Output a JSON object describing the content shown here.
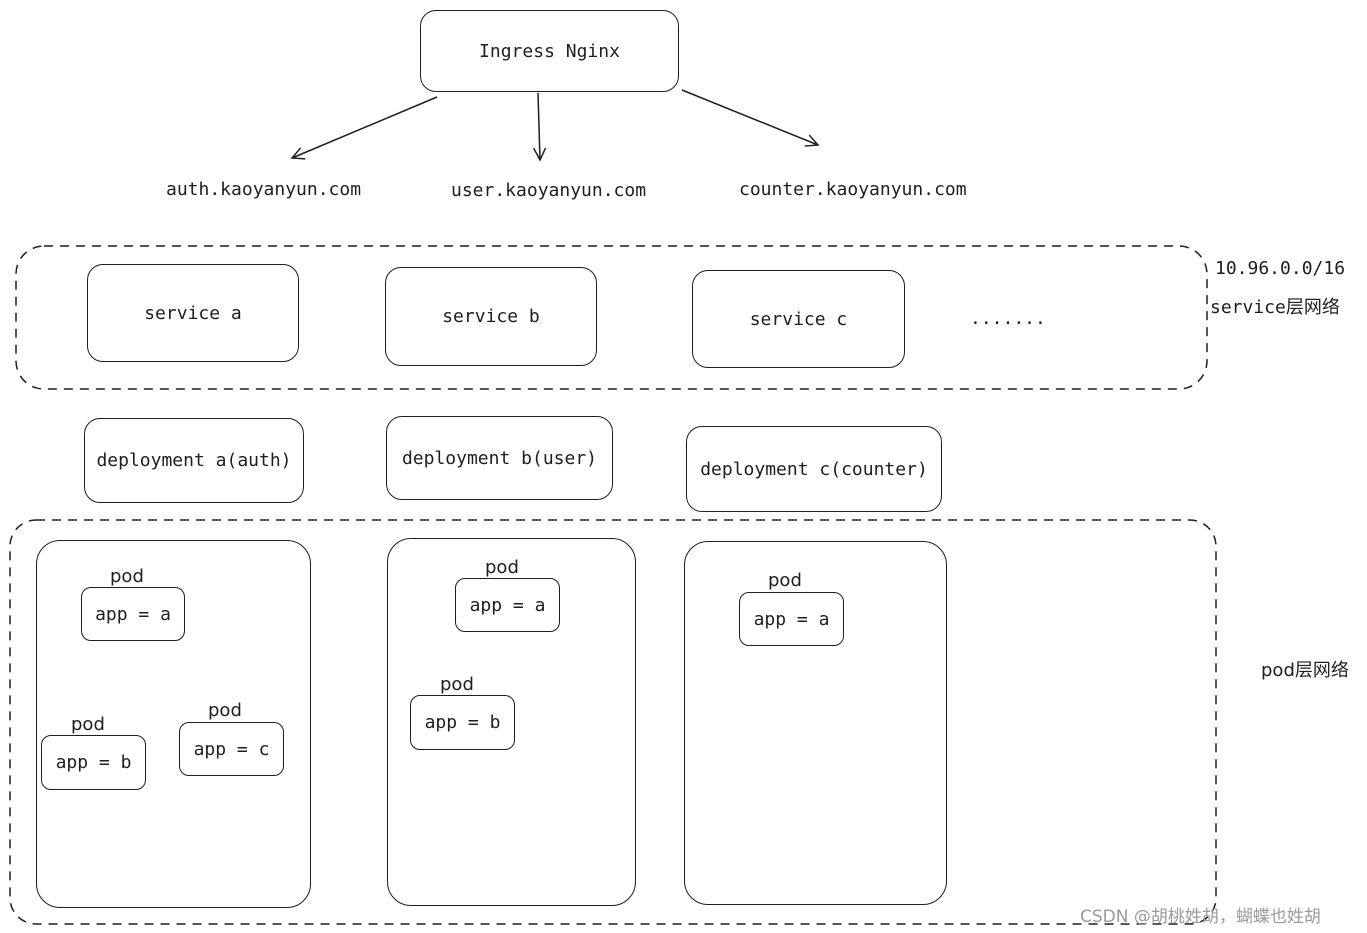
{
  "ingress": {
    "label": "Ingress Nginx"
  },
  "domains": [
    "auth.kaoyanyun.com",
    "user.kaoyanyun.com",
    "counter.kaoyanyun.com"
  ],
  "service_layer": {
    "cidr": "10.96.0.0/16",
    "label": "service层网络",
    "services": [
      "service a",
      "service b",
      "service c"
    ],
    "ellipsis": "......."
  },
  "deployments": [
    "deployment a(auth)",
    "deployment b(user)",
    "deployment c(counter)"
  ],
  "pod_layer": {
    "label": "pod层网络",
    "pod_label": "pod",
    "pods": [
      "app = a",
      "app = b",
      "app = c",
      "app = a",
      "app = b",
      "app = a"
    ]
  },
  "watermark": "CSDN @胡桃姓胡，蝴蝶也姓胡"
}
